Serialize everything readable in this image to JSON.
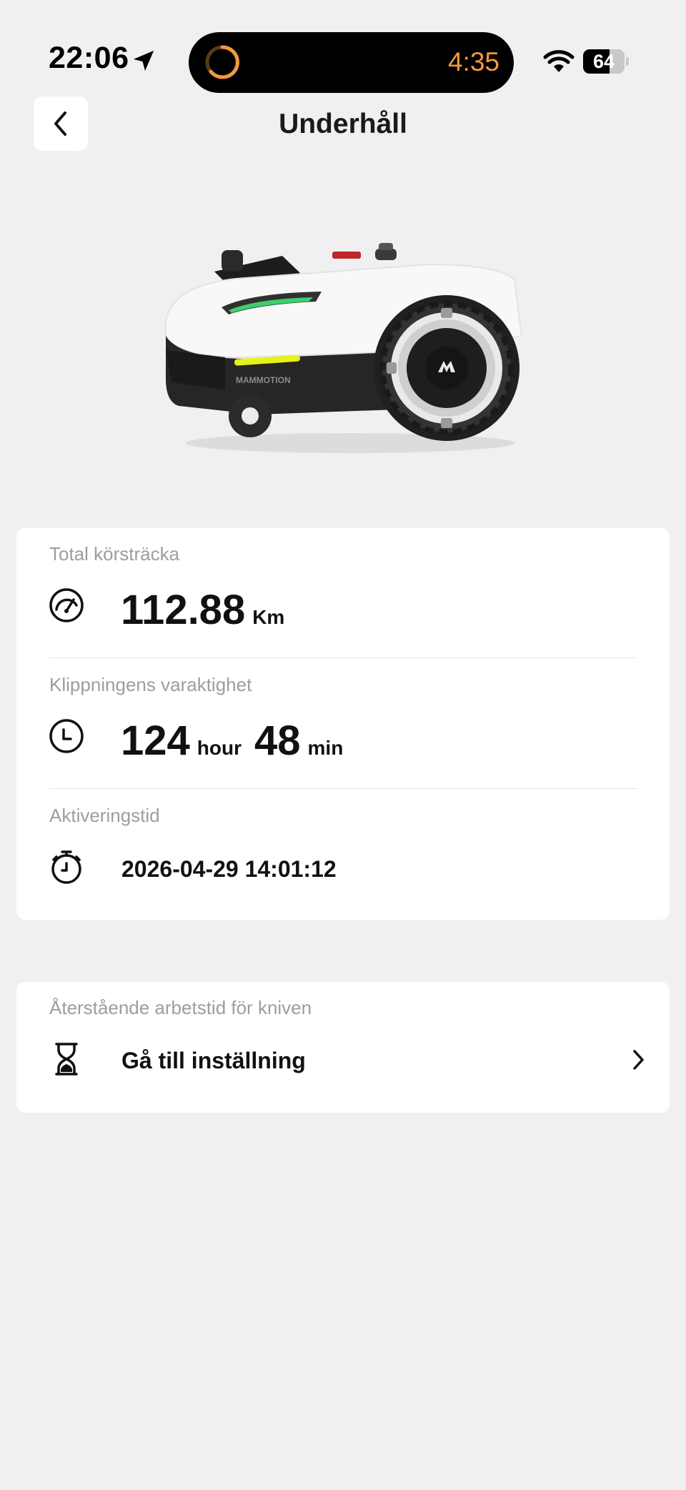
{
  "status_bar": {
    "time": "22:06",
    "island_timer": "4:35",
    "battery_percent": "64",
    "battery_level": 0.64,
    "timer_color": "#f39a3c"
  },
  "header": {
    "title": "Underhåll",
    "back_icon": "chevron-left-icon"
  },
  "product": {
    "image": "robotic-lawn-mower",
    "brand_mark": "MAMMOTION"
  },
  "stats": {
    "distance": {
      "label": "Total körsträcka",
      "value": "112.88",
      "unit": "Km",
      "icon": "speedometer-icon"
    },
    "duration": {
      "label": "Klippningens varaktighet",
      "hours": "124",
      "hours_unit": "hour",
      "minutes": "48",
      "minutes_unit": "min",
      "icon": "clock-icon"
    },
    "activation": {
      "label": "Aktiveringstid",
      "value": "2026-04-29 14:01:12",
      "icon": "stopwatch-icon"
    }
  },
  "blade": {
    "label": "Återstående arbetstid för kniven",
    "action": "Gå till inställning",
    "icon": "hourglass-icon"
  },
  "colors": {
    "background": "#f0f0f0",
    "card": "#ffffff",
    "label_gray": "#9d9d9d",
    "accent_green": "#3ccf6b",
    "accent_yellow": "#e6f21a"
  }
}
